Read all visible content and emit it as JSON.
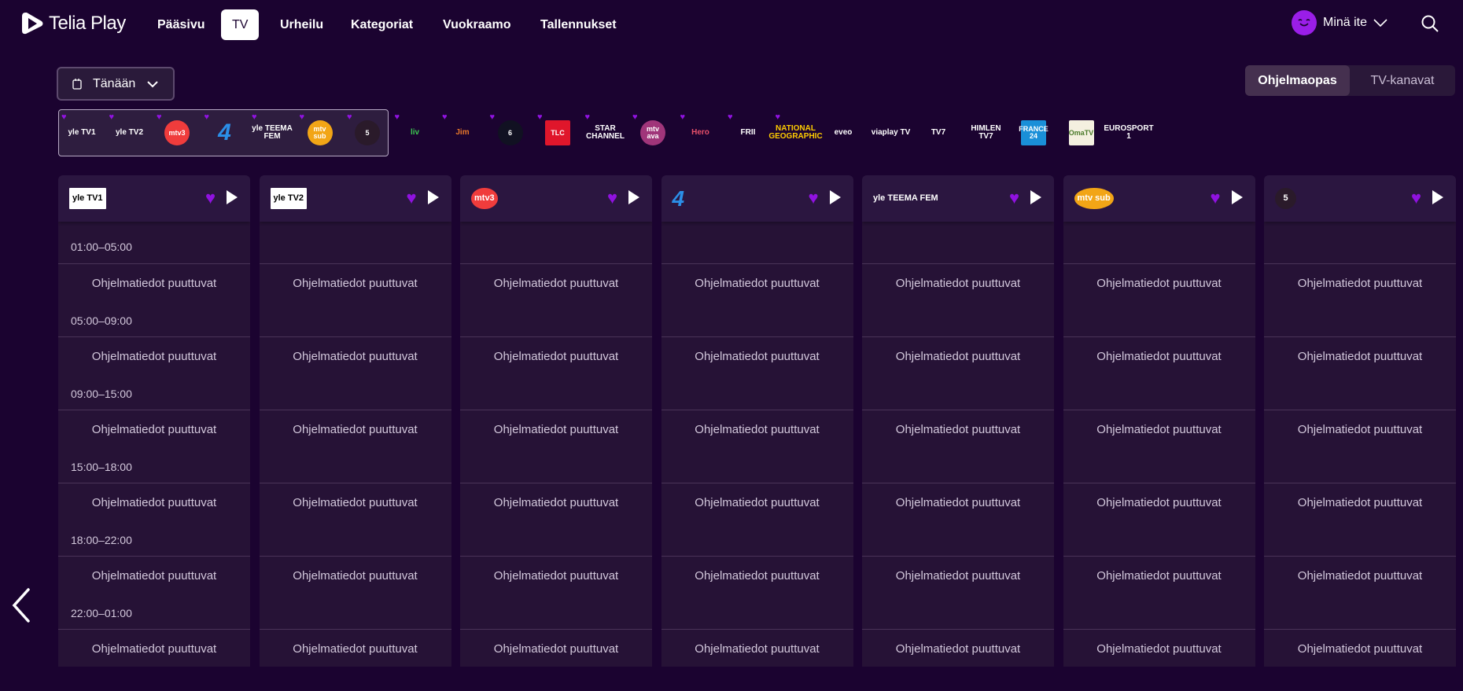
{
  "nav": {
    "brand": "Telia Play",
    "items": [
      "Pääsivu",
      "TV",
      "Urheilu",
      "Kategoriat",
      "Vuokraamo",
      "Tallennukset"
    ],
    "active": 1,
    "user": "Minä ite"
  },
  "date_label": "Tänään",
  "view_toggle": [
    "Ohjelmaopas",
    "TV-kanavat"
  ],
  "channels": [
    {
      "name": "yle TV1",
      "bg": "",
      "color": "#fff",
      "fav": true
    },
    {
      "name": "yle TV2",
      "bg": "",
      "color": "#fff",
      "fav": true
    },
    {
      "name": "mtv3",
      "bg": "#f03c3c",
      "color": "#fff",
      "fav": true
    },
    {
      "name": "4",
      "bg": "",
      "color": "#2b8fe8",
      "fav": true
    },
    {
      "name": "yle TEEMA FEM",
      "bg": "",
      "color": "#fff",
      "fav": true
    },
    {
      "name": "mtv sub",
      "bg": "#f2a516",
      "color": "#fff",
      "fav": true
    },
    {
      "name": "5",
      "bg": "#2a1a2a",
      "color": "#fff",
      "fav": true
    },
    {
      "name": "liv",
      "bg": "",
      "color": "#3cc850",
      "fav": true
    },
    {
      "name": "Jim",
      "bg": "",
      "color": "#e8782a",
      "fav": true
    },
    {
      "name": "6",
      "bg": "#112",
      "color": "#fff",
      "fav": true
    },
    {
      "name": "TLC",
      "bg": "#e0162b",
      "color": "#fff",
      "fav": true
    },
    {
      "name": "STAR CHANNEL",
      "bg": "",
      "color": "#fff",
      "fav": true
    },
    {
      "name": "mtv ava",
      "bg": "#a0357a",
      "color": "#fff",
      "fav": true
    },
    {
      "name": "Hero",
      "bg": "",
      "color": "#e8506a",
      "fav": true
    },
    {
      "name": "FRII",
      "bg": "",
      "color": "#fff",
      "fav": true
    },
    {
      "name": "NATIONAL GEOGRAPHIC",
      "bg": "",
      "color": "#ffcc00",
      "fav": true
    },
    {
      "name": "eveo",
      "bg": "",
      "color": "#fff",
      "fav": false
    },
    {
      "name": "viaplay TV",
      "bg": "",
      "color": "#fff",
      "fav": false
    },
    {
      "name": "TV7",
      "bg": "",
      "color": "#fff",
      "fav": false
    },
    {
      "name": "HIMLEN TV7",
      "bg": "",
      "color": "#fff",
      "fav": false
    },
    {
      "name": "FRANCE 24",
      "bg": "#1a8fd8",
      "color": "#fff",
      "fav": false
    },
    {
      "name": "OmaTV",
      "bg": "#f4f0e0",
      "color": "#4a7a2a",
      "fav": false
    },
    {
      "name": "EUROSPORT 1",
      "bg": "",
      "color": "#fff",
      "fav": false
    }
  ],
  "columns": [
    {
      "name": "yle TV1",
      "logo_bg": "#fff",
      "logo_color": "#000"
    },
    {
      "name": "yle TV2",
      "logo_bg": "#fff",
      "logo_color": "#000"
    },
    {
      "name": "mtv3",
      "logo_bg": "#f03c3c",
      "logo_color": "#fff"
    },
    {
      "name": "4",
      "logo_bg": "",
      "logo_color": "#2b8fe8"
    },
    {
      "name": "yle TEEMA FEM",
      "logo_bg": "",
      "logo_color": "#fff"
    },
    {
      "name": "mtv sub",
      "logo_bg": "#f2a516",
      "logo_color": "#fff"
    },
    {
      "name": "5",
      "logo_bg": "#2a1a2a",
      "logo_color": "#fff"
    }
  ],
  "times": [
    "01:00–05:00",
    "05:00–09:00",
    "09:00–15:00",
    "15:00–18:00",
    "18:00–22:00",
    "22:00–01:00"
  ],
  "missing_text": "Ohjelmatiedot puuttuvat",
  "colors": {
    "heart": "#9012e0",
    "background": "#1b0330"
  }
}
